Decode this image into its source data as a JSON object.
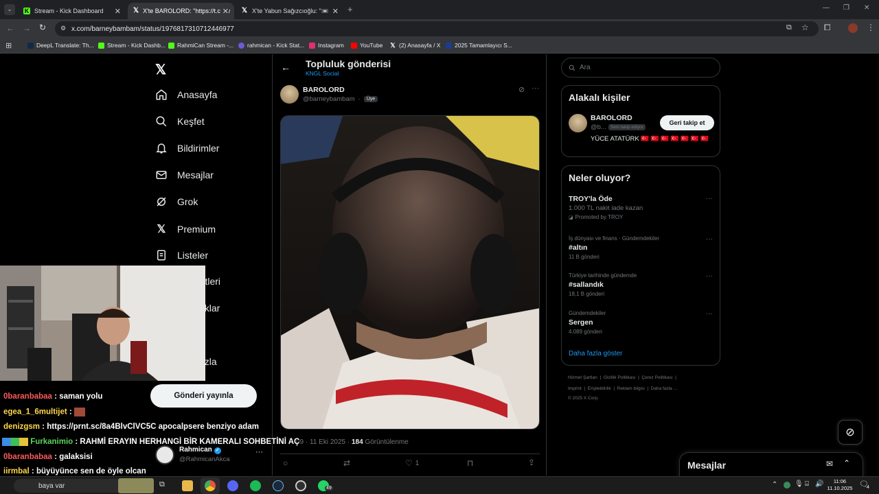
{
  "browser": {
    "tabs": [
      {
        "label": "Stream - Kick Dashboard",
        "favicon": "kick-icon",
        "active": false
      },
      {
        "label": "X'te BAROLORD: \"https://t.co/w",
        "favicon": "x-icon",
        "active": true
      },
      {
        "label": "X'te Yabun Sağızcıoğlu: \"📼 Ki",
        "favicon": "x-icon",
        "active": false
      }
    ],
    "url": "x.com/barneybambam/status/1976817310712446977",
    "bookmarks": [
      {
        "label": "DeepL Translate: Th...",
        "color": "#0f2b46"
      },
      {
        "label": "Stream - Kick Dashb...",
        "color": "#53fc18"
      },
      {
        "label": "RahmiCan Stream -...",
        "color": "#53fc18"
      },
      {
        "label": "rahmican - Kick Stat...",
        "color": "#6b5bd6"
      },
      {
        "label": "Instagram",
        "color": "#e1306c"
      },
      {
        "label": "YouTube",
        "color": "#ff0000"
      },
      {
        "label": "(2) Anasayfa / X",
        "color": "#ffffff"
      },
      {
        "label": "2025 Tamamlayıcı S...",
        "color": "#1a3d8f"
      }
    ]
  },
  "nav": {
    "items": [
      {
        "label": "Anasayfa",
        "icon": "home-icon"
      },
      {
        "label": "Keşfet",
        "icon": "search-icon"
      },
      {
        "label": "Bildirimler",
        "icon": "bell-icon"
      },
      {
        "label": "Mesajlar",
        "icon": "mail-icon"
      },
      {
        "label": "Grok",
        "icon": "grok-icon"
      },
      {
        "label": "Premium",
        "icon": "x-logo-icon"
      },
      {
        "label": "Listeler",
        "icon": "list-icon"
      },
      {
        "label": "retleri",
        "icon": ""
      },
      {
        "label": "uklar",
        "icon": ""
      },
      {
        "label": "azla",
        "icon": ""
      }
    ],
    "post_button": "Gönderi yayınla",
    "account": {
      "name": "Rahmican",
      "handle": "@RahmicanAkca"
    }
  },
  "post": {
    "header_title": "Topluluk gönderisi",
    "header_subtitle": "KNGL Social",
    "author_name": "BAROLORD",
    "author_handle": "@barneybambam",
    "member_badge": "Üye",
    "meta_time": "09 · 11 Eki 2025",
    "views_count": "184",
    "views_label": "Görüntülenme",
    "like_count": "1"
  },
  "right": {
    "search_placeholder": "Ara",
    "related_title": "Alakalı kişiler",
    "related_person": {
      "name": "BAROLORD",
      "handle": "@b...",
      "follows_you": "Seni takip ediyor",
      "bio": "YÜCE ATATÜRK 🇹🇷 🇹🇷 🇹🇷 🇹🇷 🇹🇷 🇹🇷 🇹🇷",
      "follow_button": "Geri takip et"
    },
    "trends_title": "Neler oluyor?",
    "trends": [
      {
        "context": "",
        "name": "TROY'la Öde",
        "sub": "1.000 TL nakit iade kazan",
        "promo": "Promoted by TROY"
      },
      {
        "context": "İş dünyası ve finans · Gündemdekiler",
        "name": "#altın",
        "sub": "11 B gönderi",
        "promo": ""
      },
      {
        "context": "Türkiye tarihinde gündemde",
        "name": "#sallandık",
        "sub": "18,1 B gönderi",
        "promo": ""
      },
      {
        "context": "Gündemdekiler",
        "name": "Sergen",
        "sub": "4.089 gönderi",
        "promo": ""
      }
    ],
    "show_more": "Daha fazla göster",
    "footer": {
      "line1": [
        "Hizmet Şartları",
        "Gizlilik Politikası",
        "Çerez Politikası"
      ],
      "line2": [
        "Imprint",
        "Erişilebilirlik",
        "Reklam bilgisi",
        "Daha fazla ..."
      ],
      "copyright": "© 2025 X Corp."
    },
    "messages_label": "Mesajlar"
  },
  "chat": [
    {
      "user": "0baranbabaa",
      "color": "#ff5a5a",
      "text": "saman yolu"
    },
    {
      "user": "egea_1_6multijet",
      "color": "#ffd84a",
      "text": ""
    },
    {
      "user": "denizgsm",
      "color": "#ffd84a",
      "text": "https://prnt.sc/8a4BlvClVC5C apocalpsere benziyo adam"
    },
    {
      "user": "Furkanimio",
      "color": "#5bd45b",
      "text": "RAHMİ ERAYIN HERHANGİ BİR KAMERALI SOHBETİNİ AÇ"
    },
    {
      "user": "0baranbabaa",
      "color": "#ff5a5a",
      "text": "galaksisi"
    },
    {
      "user": "iirmbal",
      "color": "#ffd84a",
      "text": "büyüyünce sen de öyle olcan"
    }
  ],
  "taskbar": {
    "search_text": "baya var",
    "time": "11:06",
    "date": "11.10.2025",
    "notif_count": "4",
    "whatsapp_badge": "49"
  }
}
